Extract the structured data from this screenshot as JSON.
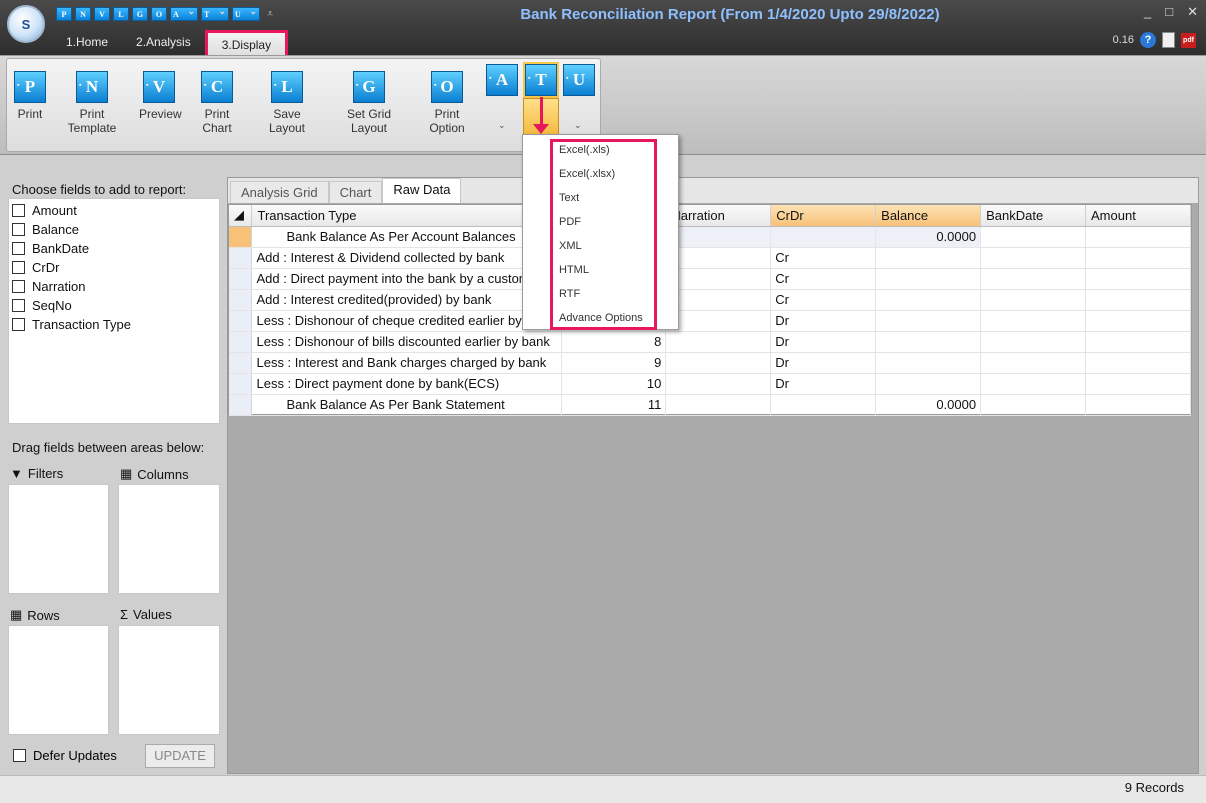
{
  "window": {
    "title": "Bank Reconciliation Report (From 1/4/2020 Upto 29/8/2022)",
    "logo_text": "S",
    "controls": [
      "_",
      "□",
      "✕"
    ]
  },
  "quick_access": [
    "P",
    "N",
    "V",
    "L",
    "G",
    "O",
    "A",
    "T",
    "U"
  ],
  "ribbon_tabs": [
    "1.Home",
    "2.Analysis",
    "3.Display"
  ],
  "version": "0.16",
  "ribbon_buttons": [
    {
      "letter": "P",
      "label": "Print"
    },
    {
      "letter": "N",
      "label": "Print Template"
    },
    {
      "letter": "V",
      "label": "Preview"
    },
    {
      "letter": "C",
      "label": "Print Chart"
    },
    {
      "letter": "L",
      "label": "Save Layout"
    },
    {
      "letter": "G",
      "label": "Set Grid Layout"
    },
    {
      "letter": "O",
      "label": "Print Option"
    }
  ],
  "small_buttons": [
    "A",
    "T",
    "U"
  ],
  "left_panel": {
    "choose_label": "Choose fields to add to report:",
    "fields": [
      "Amount",
      "Balance",
      "BankDate",
      "CrDr",
      "Narration",
      "SeqNo",
      "Transaction Type"
    ],
    "drag_label": "Drag fields between areas below:",
    "zones": {
      "filters": "Filters",
      "columns": "Columns",
      "rows": "Rows",
      "values": "Values"
    },
    "defer_label": "Defer Updates",
    "update_label": "UPDATE"
  },
  "view_tabs": [
    "Analysis Grid",
    "Chart",
    "Raw Data"
  ],
  "grid": {
    "columns": [
      "Transaction Type",
      "",
      "Narration",
      "CrDr",
      "Balance",
      "BankDate",
      "Amount"
    ],
    "rows": [
      [
        "Bank Balance As Per Account Balances",
        "",
        "",
        "",
        "0.0000",
        "",
        ""
      ],
      [
        "Add  : Interest & Dividend collected by bank",
        "",
        "",
        "Cr",
        "",
        "",
        ""
      ],
      [
        "Add  : Direct payment into the bank by a customer",
        "",
        "",
        "Cr",
        "",
        "",
        ""
      ],
      [
        "Add  : Interest credited(provided) by bank",
        "",
        "",
        "Cr",
        "",
        "",
        ""
      ],
      [
        "Less : Dishonour of cheque credited earlier by bank",
        "",
        "",
        "Dr",
        "",
        "",
        ""
      ],
      [
        "Less : Dishonour of bills discounted earlier by bank",
        "8",
        "",
        "Dr",
        "",
        "",
        ""
      ],
      [
        "Less : Interest and Bank charges charged by bank",
        "9",
        "",
        "Dr",
        "",
        "",
        ""
      ],
      [
        "Less : Direct payment done by bank(ECS)",
        "10",
        "",
        "Dr",
        "",
        "",
        ""
      ],
      [
        "Bank Balance As Per Bank Statement",
        "11",
        "",
        "",
        "0.0000",
        "",
        ""
      ]
    ]
  },
  "export_menu": [
    "Excel(.xls)",
    "Excel(.xlsx)",
    "Text",
    "PDF",
    "XML",
    "HTML",
    "RTF",
    "Advance Options"
  ],
  "status": {
    "records": "9 Records"
  },
  "colors": {
    "highlight": "#e8175d",
    "accent": "#0a82d8"
  }
}
